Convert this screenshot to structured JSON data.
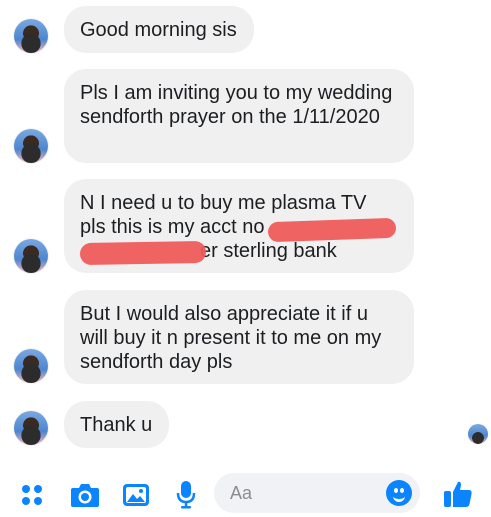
{
  "messages": [
    {
      "text": "Good morning sis"
    },
    {
      "text": "Pls I am inviting you to my wedding sendforth prayer on the 1/11/2020"
    },
    {
      "text_lines": [
        "N I need u to buy me plasma TV",
        "pls this is my acct no",
        "er sterling bank"
      ]
    },
    {
      "text": "But I would also appreciate it if u will buy it n present it to me on my sendforth day pls"
    },
    {
      "text": "Thank u"
    }
  ],
  "composer": {
    "placeholder": "Aa",
    "icons": [
      "apps-icon",
      "camera-icon",
      "gallery-icon",
      "microphone-icon",
      "emoji-icon",
      "thumbs-up-icon"
    ]
  },
  "colors": {
    "accent": "#0a84ff",
    "bubble": "#f0f0f0",
    "redaction": "#ef5b5b"
  }
}
